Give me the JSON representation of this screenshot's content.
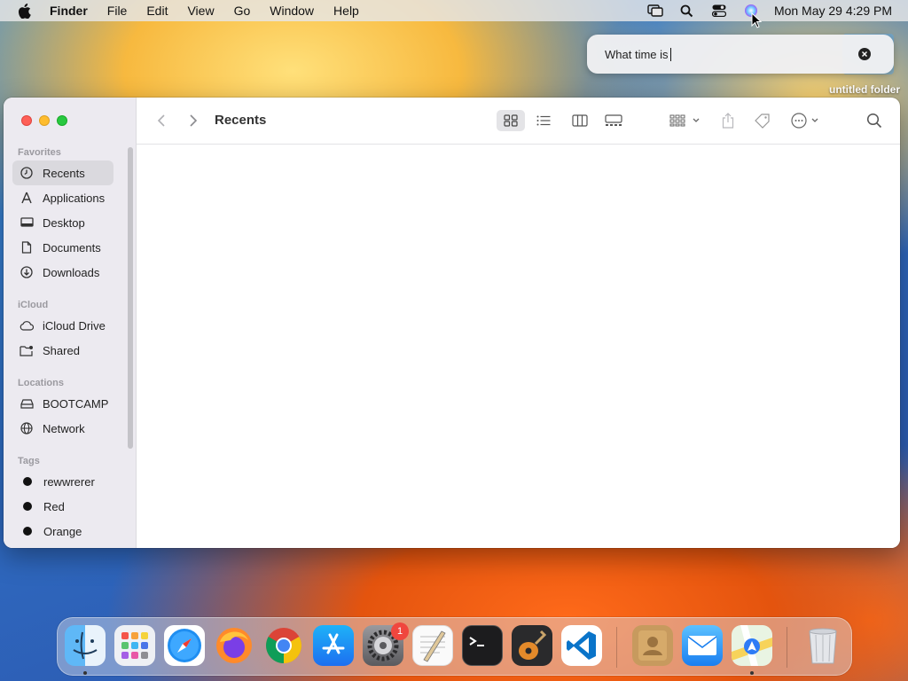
{
  "menubar": {
    "app_name": "Finder",
    "menus": [
      "File",
      "Edit",
      "View",
      "Go",
      "Window",
      "Help"
    ],
    "clock": "Mon May 29  4:29 PM",
    "status_icons": [
      "screen-mirroring-icon",
      "spotlight-icon",
      "control-center-icon",
      "siri-icon"
    ]
  },
  "siri": {
    "query": "What time is"
  },
  "desktop": {
    "folder_label": "untitled folder"
  },
  "finder": {
    "title": "Recents",
    "sidebar": {
      "favorites_label": "Favorites",
      "favorites": [
        {
          "label": "Recents",
          "icon": "clock-icon"
        },
        {
          "label": "Applications",
          "icon": "applications-icon"
        },
        {
          "label": "Desktop",
          "icon": "desktop-icon"
        },
        {
          "label": "Documents",
          "icon": "document-icon"
        },
        {
          "label": "Downloads",
          "icon": "download-icon"
        }
      ],
      "icloud_label": "iCloud",
      "icloud": [
        {
          "label": "iCloud Drive",
          "icon": "cloud-icon"
        },
        {
          "label": "Shared",
          "icon": "shared-folder-icon"
        }
      ],
      "locations_label": "Locations",
      "locations": [
        {
          "label": "BOOTCAMP",
          "icon": "drive-icon"
        },
        {
          "label": "Network",
          "icon": "globe-icon"
        }
      ],
      "tags_label": "Tags",
      "tags": [
        {
          "label": "rewwrerer",
          "color": "#111111"
        },
        {
          "label": "Red",
          "color": "#111111"
        },
        {
          "label": "Orange",
          "color": "#111111"
        }
      ]
    }
  },
  "dock": {
    "apps": [
      "Finder",
      "Launchpad",
      "Safari",
      "Firefox",
      "Chrome",
      "App Store",
      "System Settings",
      "TextEdit",
      "Terminal",
      "GarageBand",
      "VS Code",
      "Contacts",
      "Mail",
      "Maps",
      "Trash"
    ],
    "system_settings_badge": "1"
  }
}
